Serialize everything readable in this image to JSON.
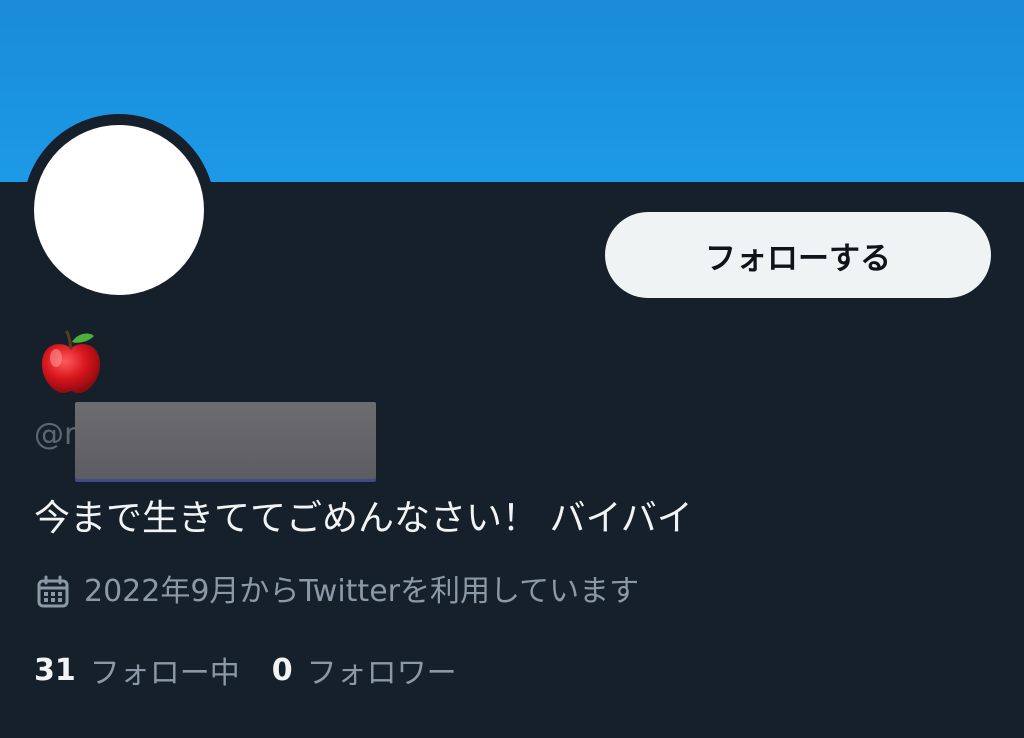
{
  "profile": {
    "display_name_emoji": "apple-emoji",
    "handle_prefix": "@r",
    "bio": "今まで生きててごめんなさい！ バイバイ",
    "joined": "2022年9月からTwitterを利用しています",
    "follow_button_label": "フォローする"
  },
  "stats": {
    "following_count": "31",
    "following_label": "フォロー中",
    "followers_count": "0",
    "followers_label": "フォロワー"
  },
  "colors": {
    "banner": "#1c9ae8",
    "background": "#16202b",
    "button_bg": "#eff3f4",
    "secondary_text": "#8b98a5",
    "primary_text": "#f1f3f4"
  },
  "icons": {
    "calendar": "calendar-icon",
    "apple": "apple-emoji"
  }
}
